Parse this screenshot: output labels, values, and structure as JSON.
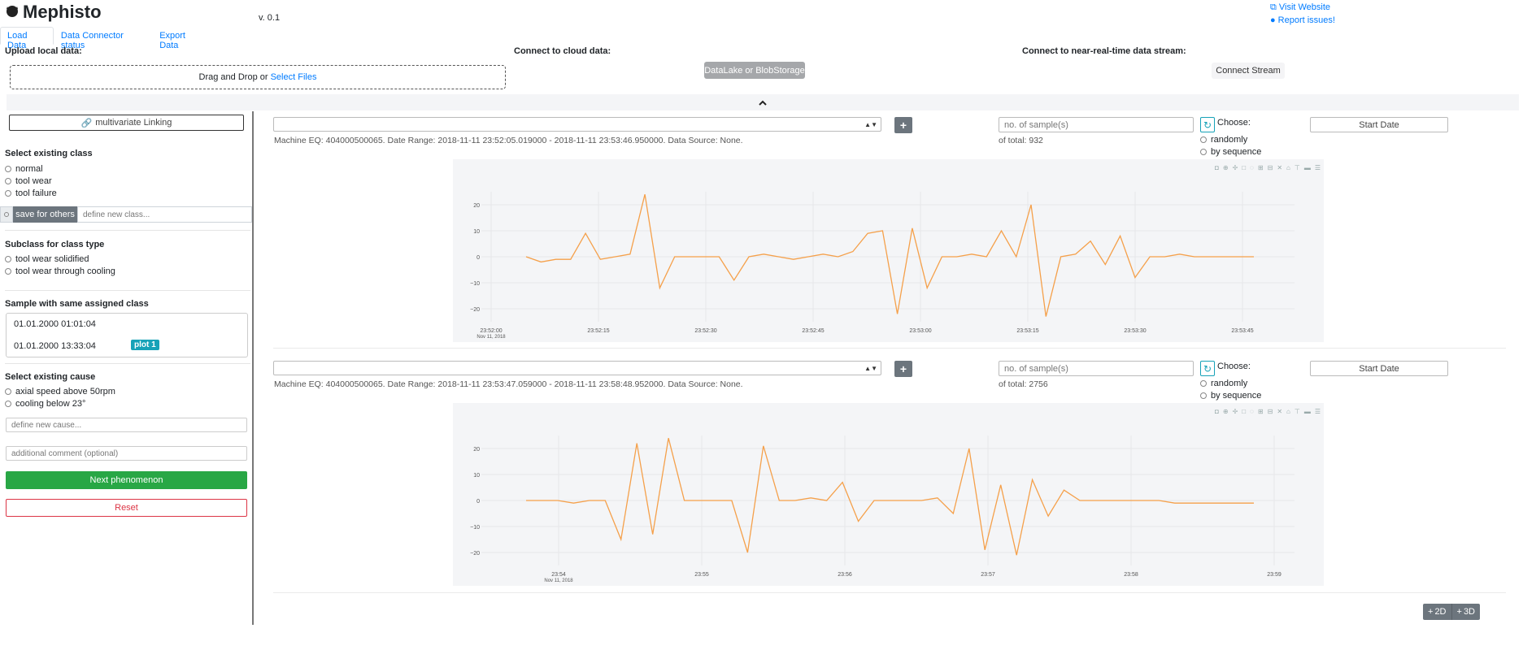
{
  "header": {
    "app_name": "Mephisto",
    "version": "v. 0.1",
    "visit_website": "Visit Website",
    "report_issues": "Report issues!"
  },
  "tabs": [
    {
      "label": "Load Data",
      "active": true
    },
    {
      "label": "Data Connector status",
      "active": false
    },
    {
      "label": "Export Data",
      "active": false
    }
  ],
  "upload": {
    "label": "Upload local data:",
    "drop_text": "Drag and Drop or ",
    "select_files": "Select Files"
  },
  "cloud": {
    "label": "Connect to cloud data:",
    "button": "DataLake or BlobStorage"
  },
  "stream": {
    "label": "Connect to near-real-time data stream:",
    "button": "Connect Stream"
  },
  "sidebar": {
    "multivariate_button": "multivariate Linking",
    "existing_class_heading": "Select existing class",
    "classes": [
      "normal",
      "tool wear",
      "tool failure"
    ],
    "save_button": "save for others",
    "new_class_placeholder": "define new class...",
    "subclass_heading": "Subclass for class type",
    "subclasses": [
      "tool wear solidified",
      "tool wear through cooling"
    ],
    "sample_heading": "Sample with same assigned class",
    "samples": [
      {
        "time": "01.01.2000 01:01:04"
      },
      {
        "time": "01.01.2000 13:33:04",
        "badge": "plot 1"
      }
    ],
    "cause_heading": "Select existing cause",
    "causes": [
      "axial speed above 50rpm",
      "cooling below 23°"
    ],
    "new_cause_placeholder": "define new cause...",
    "comment_placeholder": "additional comment (optional)",
    "next_button": "Next phenomenon",
    "reset_button": "Reset"
  },
  "panels": [
    {
      "meta": "Machine EQ: 404000500065. Date Range: 2018-11-11 23:52:05.019000 - 2018-11-11 23:53:46.950000. Data Source: None.",
      "samples_placeholder": "no. of sample(s)",
      "total": "of total: 932",
      "choose_label": "Choose:",
      "options": [
        "randomly",
        "by sequence"
      ],
      "start_date": "Start Date",
      "x_ticks": [
        "23:52:00",
        "23:52:15",
        "23:52:30",
        "23:52:45",
        "23:53:00",
        "23:53:15",
        "23:53:30",
        "23:53:45"
      ],
      "x_date": "Nov 11, 2018",
      "y_ticks": [
        "20",
        "10",
        "0",
        "−10",
        "−20"
      ]
    },
    {
      "meta": "Machine EQ: 404000500065. Date Range: 2018-11-11 23:53:47.059000 - 2018-11-11 23:58:48.952000. Data Source: None.",
      "samples_placeholder": "no. of sample(s)",
      "total": "of total: 2756",
      "choose_label": "Choose:",
      "options": [
        "randomly",
        "by sequence"
      ],
      "start_date": "Start Date",
      "x_ticks": [
        "23:54",
        "23:55",
        "23:56",
        "23:57",
        "23:58",
        "23:59"
      ],
      "x_date": "Nov 11, 2018",
      "y_ticks": [
        "20",
        "10",
        "0",
        "−10",
        "−20"
      ]
    }
  ],
  "dim_buttons": [
    "2D",
    "3D"
  ],
  "colors": {
    "line": "#f5a04a",
    "link": "#007bff",
    "success": "#28a745",
    "danger": "#dc3545",
    "info": "#17a2b8",
    "secondary": "#6c757d"
  },
  "chart_data": [
    {
      "type": "line",
      "x_range": [
        "23:52:05",
        "23:53:47"
      ],
      "ylim": [
        -25,
        25
      ],
      "series": [
        {
          "values": [
            0,
            -2,
            -1,
            -1,
            9,
            -1,
            0,
            1,
            24,
            -12,
            0,
            0,
            0,
            0,
            -9,
            0,
            1,
            0,
            -1,
            0,
            1,
            0,
            2,
            9,
            10,
            -22,
            11,
            -12,
            0,
            0,
            1,
            0,
            10,
            0,
            20,
            -23,
            0,
            1,
            6,
            -3,
            8,
            -8,
            0,
            0,
            1,
            0,
            0,
            0,
            0,
            0
          ]
        }
      ]
    },
    {
      "type": "line",
      "x_range": [
        "23:53:47",
        "23:58:49"
      ],
      "ylim": [
        -25,
        25
      ],
      "series": [
        {
          "values": [
            0,
            0,
            0,
            -1,
            0,
            0,
            -15,
            22,
            -13,
            24,
            0,
            0,
            0,
            0,
            -20,
            21,
            0,
            0,
            1,
            0,
            7,
            -8,
            0,
            0,
            0,
            0,
            1,
            -5,
            20,
            -19,
            6,
            -21,
            8,
            -6,
            4,
            0,
            0,
            0,
            0,
            0,
            0,
            -1,
            -1,
            -1,
            -1,
            -1,
            -1
          ]
        }
      ]
    }
  ]
}
